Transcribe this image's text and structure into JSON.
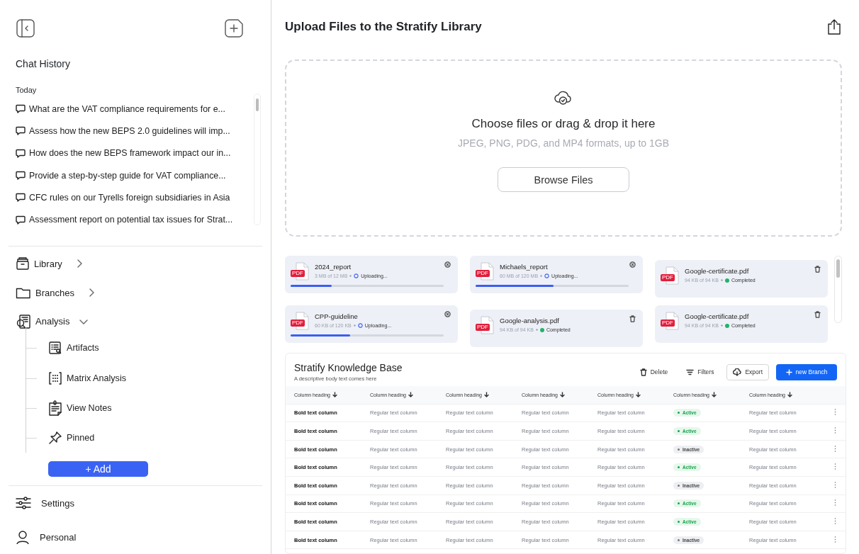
{
  "sidebar": {
    "section_title": "Chat History",
    "group_label": "Today",
    "chats": [
      "What are the VAT compliance requirements for e...",
      "Assess how the new BEPS 2.0 guidelines will imp...",
      "How does the new BEPS framework impact our in...",
      "Provide a step-by-step guide for VAT compliance...",
      "CFC rules on our Tyrells foreign subsidiaries in Asia",
      "Assessment report on potential tax issues for Strat..."
    ],
    "nav": [
      {
        "label": "Library",
        "kind": "library",
        "expanded": false
      },
      {
        "label": "Branches",
        "kind": "branches",
        "expanded": false
      },
      {
        "label": "Analysis",
        "kind": "analysis",
        "expanded": true,
        "children": [
          {
            "label": "Artifacts",
            "kind": "artifacts"
          },
          {
            "label": "Matrix Analysis",
            "kind": "matrix"
          },
          {
            "label": "View Notes",
            "kind": "notes"
          },
          {
            "label": "Pinned",
            "kind": "pinned"
          }
        ]
      }
    ],
    "add_button": "+ Add",
    "footer": [
      {
        "label": "Settings",
        "kind": "settings"
      },
      {
        "label": "Personal",
        "kind": "personal"
      }
    ]
  },
  "main": {
    "title": "Upload Files to the Stratify Library",
    "dropzone": {
      "heading": "Choose files or drag & drop it here",
      "hint": "JPEG, PNG, PDG, and MP4 formats, up to 1GB",
      "button": "Browse Files"
    },
    "files": [
      {
        "name": "2024_report",
        "badge": "PDF",
        "size": "3 MB of 12 MB",
        "status": "Uploading...",
        "kind": "uploading",
        "level": 0.27
      },
      {
        "name": "Michaels_report",
        "badge": "PDF",
        "size": "60 MB of 120 MB",
        "status": "Uploading...",
        "kind": "uploading",
        "level": 0.51
      },
      {
        "name": "Google-certificate.pdf",
        "badge": "PDF",
        "size": "94 KB of 94 KB",
        "status": "Completed",
        "kind": "completed"
      },
      {
        "name": "CPP-guideline",
        "badge": "PDF",
        "size": "60 KB of 120 KB",
        "status": "Uploading...",
        "kind": "uploading",
        "level": 0.39
      },
      {
        "name": "Google-analysis.pdf",
        "badge": "PDF",
        "size": "94 KB of 94 KB",
        "status": "Completed",
        "kind": "completed"
      },
      {
        "name": "Google-certificate.pdf",
        "badge": "PDF",
        "size": "94 KB of 94 KB",
        "status": "Completed",
        "kind": "completed"
      }
    ],
    "table": {
      "title": "Stratify Knowledge Base",
      "subtitle": "A descriptive body text comes here",
      "actions": [
        {
          "label": "Delete",
          "kind": "delete"
        },
        {
          "label": "Filters",
          "kind": "filters"
        },
        {
          "label": "Export",
          "kind": "export"
        },
        {
          "label": "new Branch",
          "kind": "primary"
        }
      ],
      "columns": [
        "Column heading",
        "Column heading",
        "Column heading",
        "Column heading",
        "Column heading",
        "Column heading",
        "Column heading"
      ],
      "rows": [
        {
          "cells": [
            "Bold text column",
            "Regular text column",
            "Regular text column",
            "Regular text column",
            "Regular text column",
            "Regular text column"
          ],
          "status": "Active",
          "active": true
        },
        {
          "cells": [
            "Bold text column",
            "Regular text column",
            "Regular text column",
            "Regular text column",
            "Regular text column",
            "Regular text column"
          ],
          "status": "Active",
          "active": true
        },
        {
          "cells": [
            "Bold text column",
            "Regular text column",
            "Regular text column",
            "Regular text column",
            "Regular text column",
            "Regular text column"
          ],
          "status": "Inactive",
          "active": false
        },
        {
          "cells": [
            "Bold text column",
            "Regular text column",
            "Regular text column",
            "Regular text column",
            "Regular text column",
            "Regular text column"
          ],
          "status": "Active",
          "active": true
        },
        {
          "cells": [
            "Bold text column",
            "Regular text column",
            "Regular text column",
            "Regular text column",
            "Regular text column",
            "Regular text column"
          ],
          "status": "Inactive",
          "active": false
        },
        {
          "cells": [
            "Bold text column",
            "Regular text column",
            "Regular text column",
            "Regular text column",
            "Regular text column",
            "Regular text column"
          ],
          "status": "Active",
          "active": true
        },
        {
          "cells": [
            "Bold text column",
            "Regular text column",
            "Regular text column",
            "Regular text column",
            "Regular text column",
            "Regular text column"
          ],
          "status": "Active",
          "active": true
        },
        {
          "cells": [
            "Bold text column",
            "Regular text column",
            "Regular text column",
            "Regular text column",
            "Regular text column",
            "Regular text column"
          ],
          "status": "Inactive",
          "active": false
        }
      ]
    }
  }
}
